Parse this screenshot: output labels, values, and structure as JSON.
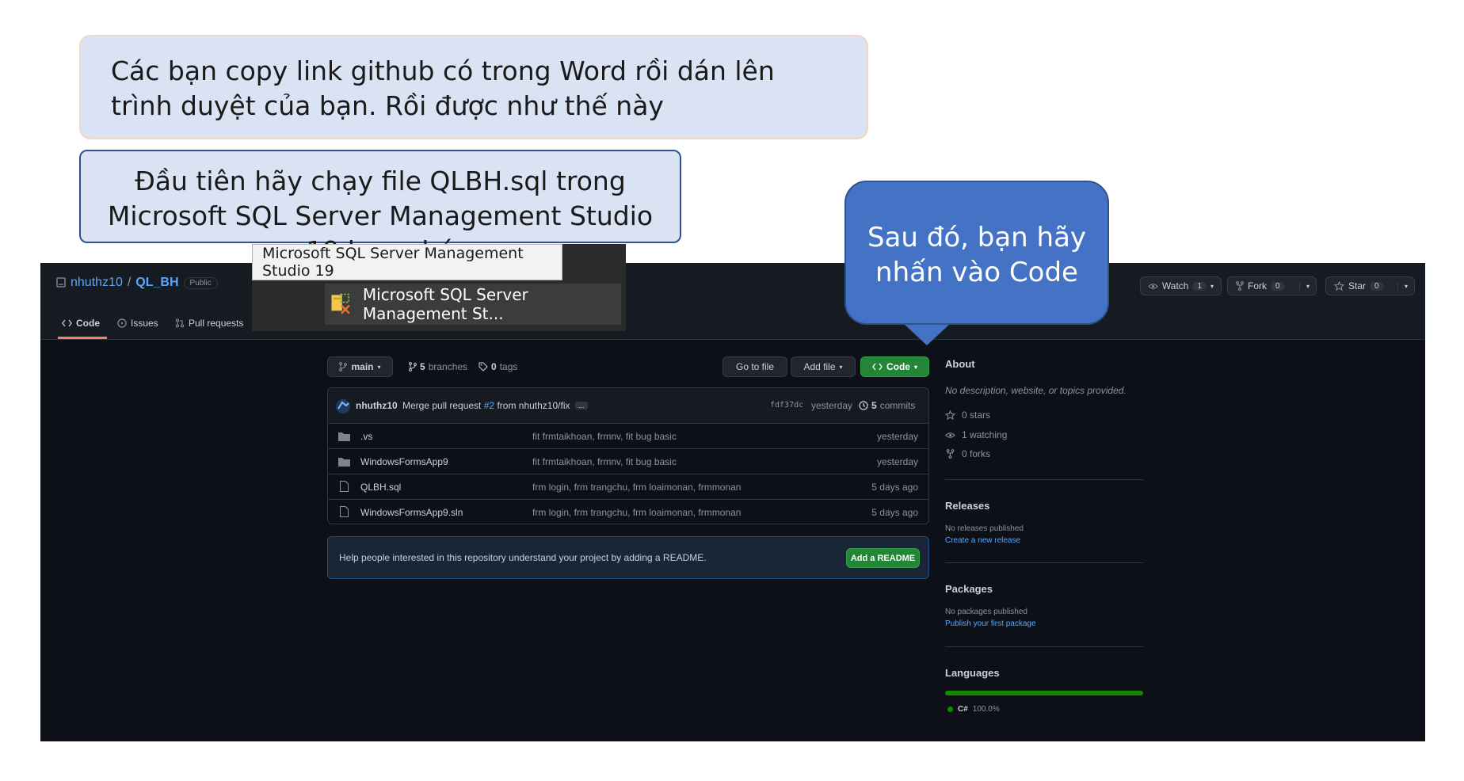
{
  "callouts": {
    "note1": "Các bạn copy link github có trong Word rồi dán lên trình duyệt của bạn. Rồi được như thế này",
    "note2": "Đầu tiên hãy chạy file QLBH.sql trong Microsoft SQL Server Management Studio 19 bạn nhé",
    "bubble": "Sau đó, bạn hãy nhấn vào Code"
  },
  "ssms": {
    "tooltip": "Microsoft SQL Server Management Studio 19",
    "item": "Microsoft SQL Server Management St..."
  },
  "repo": {
    "owner": "nhuthz10",
    "sep": "/",
    "name": "QL_BH",
    "visibility": "Public",
    "tabs": [
      "Code",
      "Issues",
      "Pull requests"
    ],
    "watch": {
      "label": "Watch",
      "count": "1"
    },
    "fork": {
      "label": "Fork",
      "count": "0"
    },
    "star": {
      "label": "Star",
      "count": "0"
    }
  },
  "toolbar": {
    "branch": "main",
    "branches_count": "5",
    "branches_label": "branches",
    "tags_count": "0",
    "tags_label": "tags",
    "go_to_file": "Go to file",
    "add_file": "Add file",
    "code": "Code"
  },
  "commit": {
    "author": "nhuthz10",
    "message_prefix": "Merge pull request",
    "pr": "#2",
    "message_suffix": "from nhuthz10/fix",
    "ellipsis": "...",
    "hash": "fdf37dc",
    "when": "yesterday",
    "commits_count": "5",
    "commits_label": "commits"
  },
  "files": [
    {
      "type": "folder",
      "name": ".vs",
      "message": "fit frmtaikhoan, frmnv, fit bug basic",
      "date": "yesterday"
    },
    {
      "type": "folder",
      "name": "WindowsFormsApp9",
      "message": "fit frmtaikhoan, frmnv, fit bug basic",
      "date": "yesterday"
    },
    {
      "type": "file",
      "name": "QLBH.sql",
      "message": "frm login, frm trangchu, frm loaimonan, frmmonan",
      "date": "5 days ago"
    },
    {
      "type": "file",
      "name": "WindowsFormsApp9.sln",
      "message": "frm login, frm trangchu, frm loaimonan, frmmonan",
      "date": "5 days ago"
    }
  ],
  "readme": {
    "text": "Help people interested in this repository understand your project by adding a README.",
    "button": "Add a README"
  },
  "sidebar": {
    "about_title": "About",
    "description": "No description, website, or topics provided.",
    "stars": "0 stars",
    "watching": "1 watching",
    "forks": "0 forks",
    "releases_title": "Releases",
    "releases_none": "No releases published",
    "releases_link": "Create a new release",
    "packages_title": "Packages",
    "packages_none": "No packages published",
    "packages_link": "Publish your first package",
    "languages_title": "Languages",
    "language_name": "C#",
    "language_pct": "100.0%",
    "language_fraction": 1.0
  },
  "colors": {
    "accent": "#4472c4",
    "green": "#238636",
    "link": "#58a6ff",
    "lang_csharp": "#178600"
  }
}
